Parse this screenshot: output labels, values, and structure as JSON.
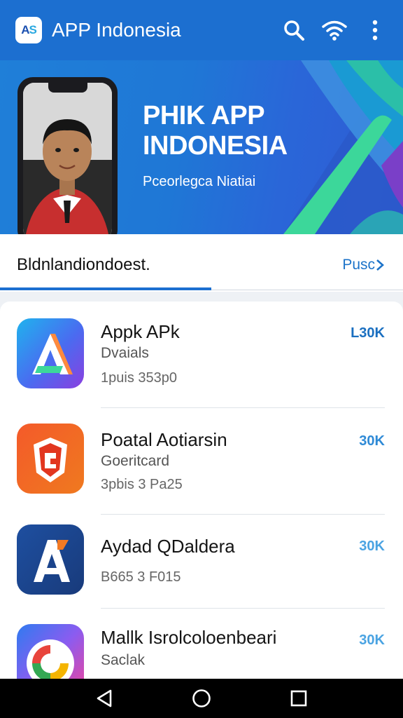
{
  "appbar": {
    "logo_text_a": "A",
    "logo_text_b": "S",
    "title": "APP Indonesia",
    "icons": [
      "search-icon",
      "wifi-icon",
      "more-vert-icon"
    ],
    "color": "#1c6fd0"
  },
  "banner": {
    "headline_line1": "PHIK APP",
    "headline_line2": "INDONESIA",
    "subline": "Pceorlegca Niatiai"
  },
  "section": {
    "title": "Bldnlandiondoest.",
    "link": "Pusc"
  },
  "apps": [
    {
      "name": "Appk APk",
      "developer": "Dvaials",
      "meta": "1puis 353p0",
      "size": "L30K",
      "size_color": "#1a6fc0"
    },
    {
      "name": "Poatal Aotiarsin",
      "developer": "Goeritcard",
      "meta": "3pbis 3 Pa25",
      "size": "30K",
      "size_color": "#2f8ad6"
    },
    {
      "name": "Aydad QDaldera",
      "developer": "",
      "meta": "B665 3 F015",
      "size": "30K",
      "size_color": "#4aa3e2"
    },
    {
      "name": "Mallk Isrolcoloenbeari",
      "developer": "Saclak",
      "meta": "",
      "size": "30K",
      "size_color": "#4aa3e2"
    }
  ],
  "sysnav": [
    "back-icon",
    "home-icon",
    "recents-icon"
  ]
}
